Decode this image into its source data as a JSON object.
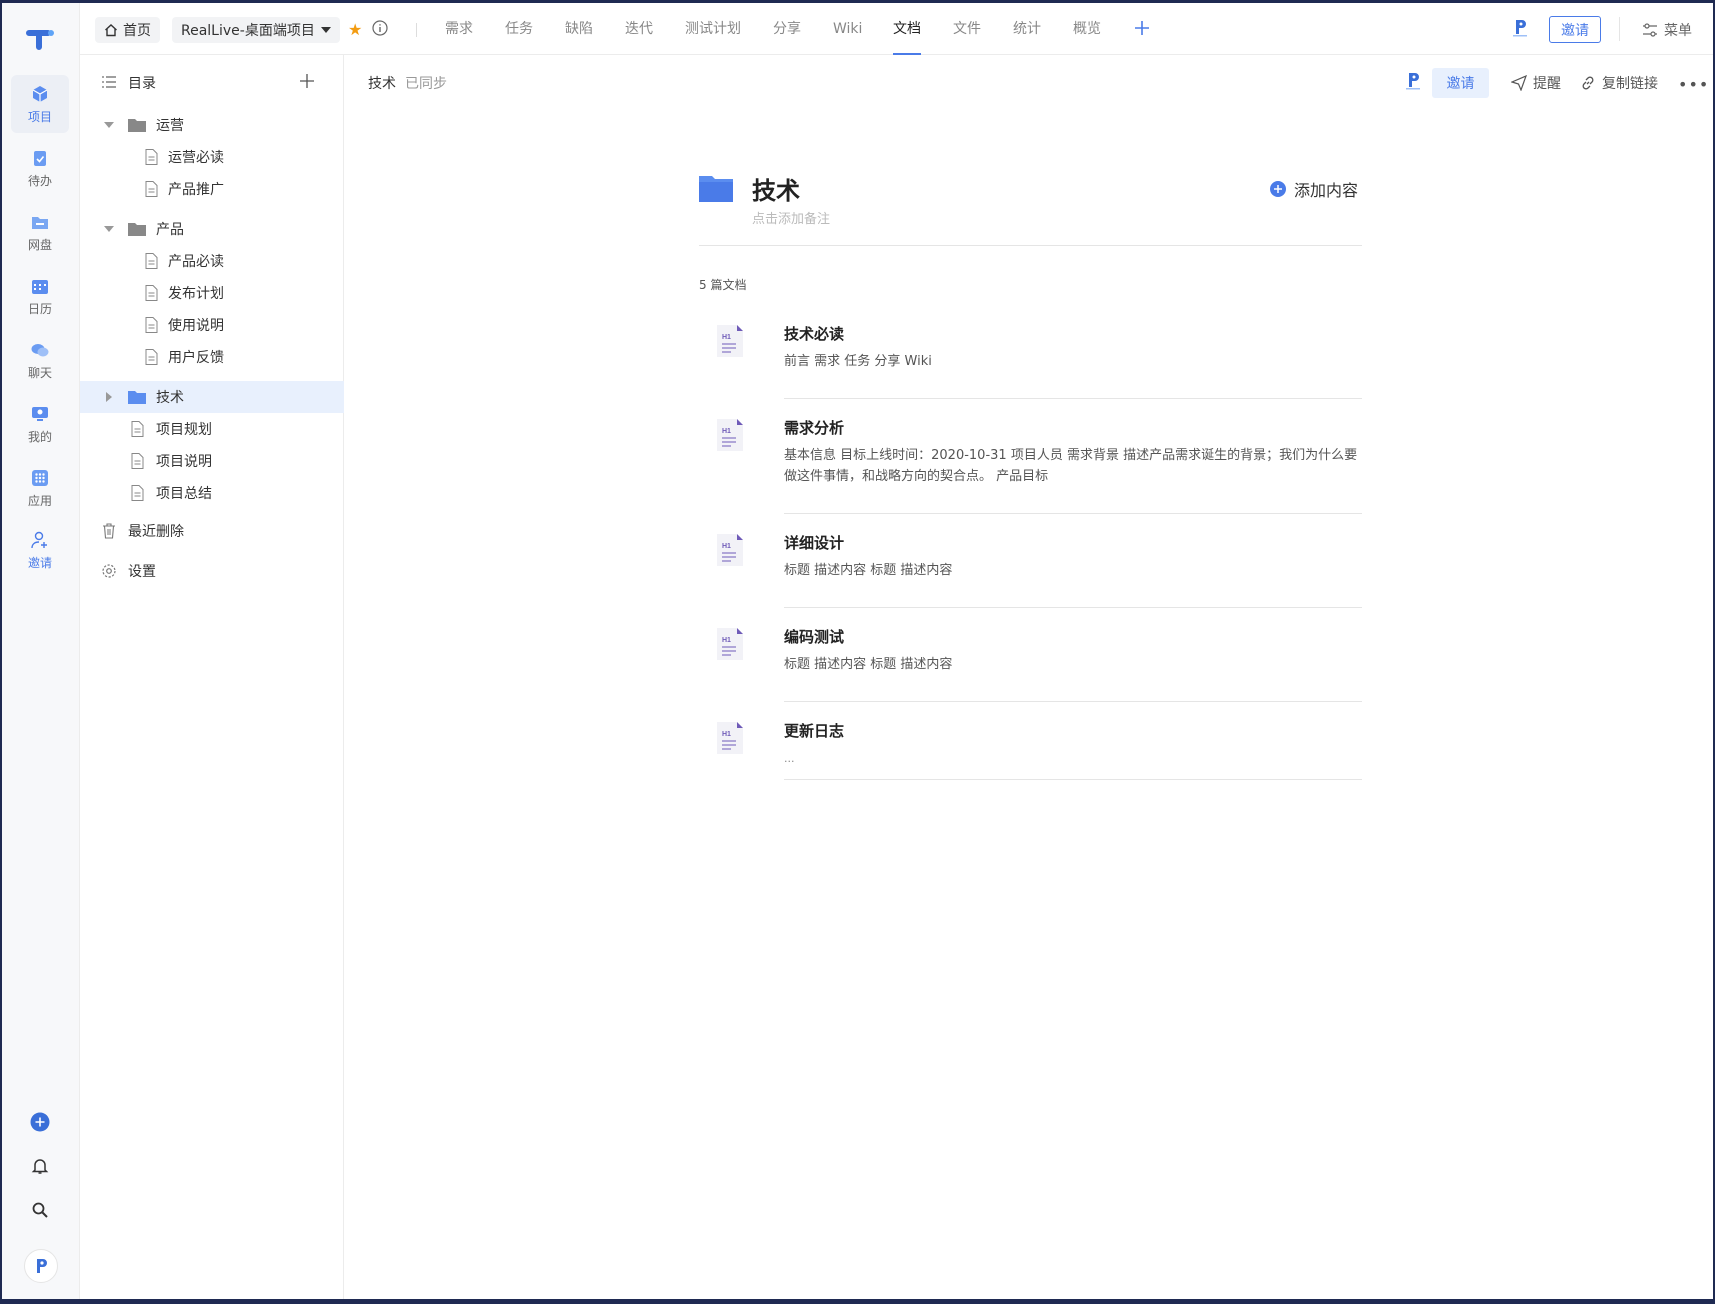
{
  "rail": {
    "items": [
      {
        "label": "项目"
      },
      {
        "label": "待办"
      },
      {
        "label": "网盘"
      },
      {
        "label": "日历"
      },
      {
        "label": "聊天"
      },
      {
        "label": "我的"
      },
      {
        "label": "应用"
      },
      {
        "label": "邀请"
      }
    ]
  },
  "topbar": {
    "home_label": "首页",
    "project_label": "RealLive-桌面端项目",
    "tabs": [
      "需求",
      "任务",
      "缺陷",
      "迭代",
      "测试计划",
      "分享",
      "Wiki",
      "文档",
      "文件",
      "统计",
      "概览"
    ],
    "active_tab": "文档",
    "invite_label": "邀请",
    "menu_label": "菜单"
  },
  "tree": {
    "header_label": "目录",
    "folders": [
      {
        "label": "运营",
        "children": [
          "运营必读",
          "产品推广"
        ]
      },
      {
        "label": "产品",
        "children": [
          "产品必读",
          "发布计划",
          "使用说明",
          "用户反馈"
        ]
      },
      {
        "label": "技术"
      }
    ],
    "docs": [
      "项目规划",
      "项目说明",
      "项目总结"
    ],
    "trash_label": "最近删除",
    "settings_label": "设置"
  },
  "content": {
    "crumb_title": "技术",
    "sync_status": "已同步",
    "invite_label": "邀请",
    "remind_label": "提醒",
    "copy_link_label": "复制链接",
    "folder_title": "技术",
    "folder_note_placeholder": "点击添加备注",
    "add_content_label": "添加内容",
    "doc_count": "5 篇文档",
    "docs": [
      {
        "title": "技术必读",
        "desc": "前言 需求 任务 分享 Wiki"
      },
      {
        "title": "需求分析",
        "desc": "基本信息 目标上线时间：2020-10-31 项目人员 需求背景 描述产品需求诞生的背景；我们为什么要做这件事情，和战略方向的契合点。 产品目标"
      },
      {
        "title": "详细设计",
        "desc": "标题 描述内容 标题 描述内容"
      },
      {
        "title": "编码测试",
        "desc": "标题 描述内容 标题 描述内容"
      },
      {
        "title": "更新日志",
        "desc": "..."
      }
    ]
  },
  "colors": {
    "accent": "#4a7be8",
    "star": "#f39c12",
    "selected_bg": "#e8f0fd"
  }
}
